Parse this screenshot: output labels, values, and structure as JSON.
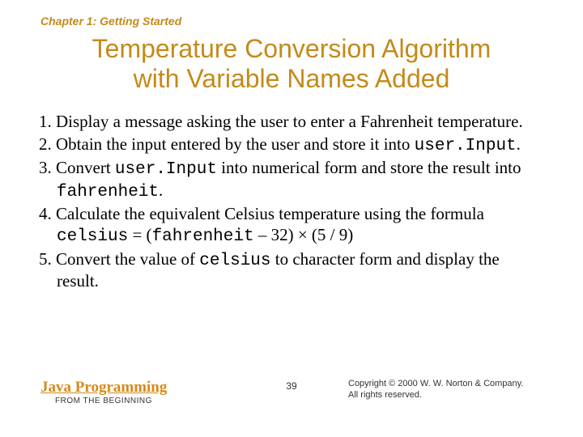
{
  "chapter": "Chapter 1: Getting Started",
  "title_line1": "Temperature Conversion Algorithm",
  "title_line2": "with Variable Names Added",
  "steps": {
    "s1_pre": "1. Display a message asking the user to enter a Fahrenheit temperature.",
    "s2_pre": "2. Obtain the input entered by the user and store it into ",
    "s2_code": "user.Input",
    "s2_post": ".",
    "s3_pre": "3. Convert ",
    "s3_code1": "user.Input",
    "s3_mid": " into numerical form and store the result into ",
    "s3_code2": "fahrenheit",
    "s3_post": ".",
    "s4_pre": "4. Calculate the equivalent Celsius temperature using the formula",
    "s4_code_a": "celsius",
    "s4_eq": " = (",
    "s4_code_b": "fahrenheit",
    "s4_rest": " – 32) × (5 / 9)",
    "s5_pre": "5. Convert the value of ",
    "s5_code": "celsius",
    "s5_post": " to character form and display the result."
  },
  "footer": {
    "brand": "Java Programming",
    "tagline": "FROM THE BEGINNING",
    "page": "39",
    "copyright1": "Copyright © 2000 W. W. Norton & Company.",
    "copyright2": "All rights reserved."
  }
}
